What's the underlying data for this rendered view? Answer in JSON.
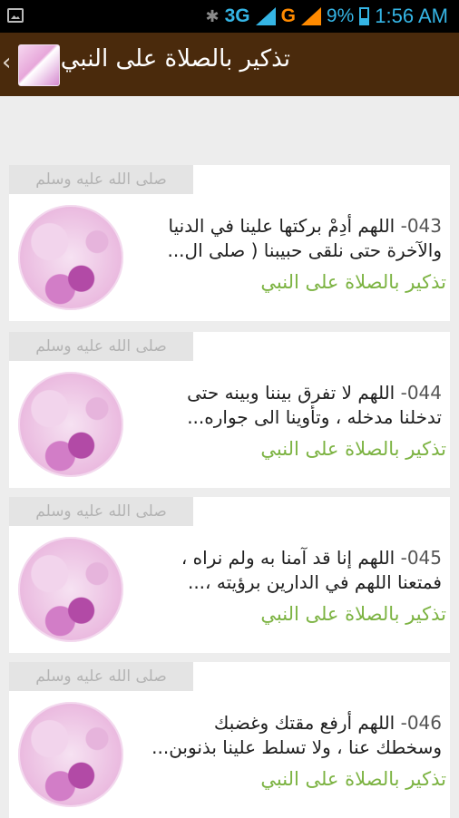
{
  "status_bar": {
    "network_1": "3G",
    "network_2": "G",
    "battery": "9%",
    "time": "1:56 AM",
    "colors": {
      "accent": "#35b5e5",
      "g": "#ff8a00"
    }
  },
  "action_bar": {
    "title": "تذكير بالصلاة على النبي",
    "back_glyph": "‹",
    "bg": "#4a2a0c"
  },
  "items": [
    {
      "tag": "صلى الله عليه وسلم",
      "number": "043-",
      "line1": "اللهم أدِمْ بركتها علينا في الدنيا",
      "line2": "والآخرة حتى نلقى حبيبنا ( صلى ال...",
      "subtitle": "تذكير بالصلاة على النبي"
    },
    {
      "tag": "صلى الله عليه وسلم",
      "number": "044-",
      "line1": "اللهم لا تفرق بيننا وبينه حتى",
      "line2": "تدخلنا مدخله ، وتأوينا الى جواره...",
      "subtitle": "تذكير بالصلاة على النبي"
    },
    {
      "tag": "صلى الله عليه وسلم",
      "number": "045-",
      "line1": "اللهم إنا قد آمنا به ولم نراه ،",
      "line2": "فمتعنا اللهم في الدارين برؤيته ،...",
      "subtitle": "تذكير بالصلاة على النبي"
    },
    {
      "tag": "صلى الله عليه وسلم",
      "number": "046-",
      "line1": "اللهم أرفع مقتك وغضبك",
      "line2": "وسخطك عنا ، ولا تسلط علينا بذنوبن...",
      "subtitle": "تذكير بالصلاة على النبي"
    }
  ]
}
